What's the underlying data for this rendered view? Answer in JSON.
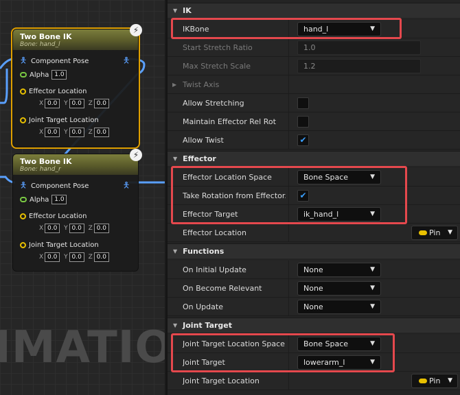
{
  "graph": {
    "watermark": "IMATION",
    "nodes": [
      {
        "title": "Two Bone IK",
        "subtitle": "Bone: hand_l",
        "component_pose": "Component Pose",
        "alpha_label": "Alpha",
        "alpha_value": "1.0",
        "effector_label": "Effector Location",
        "effector": {
          "x": "0.0",
          "y": "0.0",
          "z": "0.0"
        },
        "joint_label": "Joint Target Location",
        "joint": {
          "x": "0.0",
          "y": "0.0",
          "z": "0.0"
        }
      },
      {
        "title": "Two Bone IK",
        "subtitle": "Bone: hand_r",
        "component_pose": "Component Pose",
        "alpha_label": "Alpha",
        "alpha_value": "1.0",
        "effector_label": "Effector Location",
        "effector": {
          "x": "0.0",
          "y": "0.0",
          "z": "0.0"
        },
        "joint_label": "Joint Target Location",
        "joint": {
          "x": "0.0",
          "y": "0.0",
          "z": "0.0"
        }
      }
    ],
    "axis_labels": {
      "x": "X",
      "y": "Y",
      "z": "Z"
    },
    "pose_icon": "person-icon",
    "bolt_icon": "lightning-bolt-icon"
  },
  "panel": {
    "ik": {
      "category": "IK",
      "ikbone_label": "IKBone",
      "ikbone_value": "hand_l",
      "start_stretch_label": "Start Stretch Ratio",
      "start_stretch_value": "1.0",
      "max_stretch_label": "Max Stretch Scale",
      "max_stretch_value": "1.2",
      "twist_axis_label": "Twist Axis",
      "allow_stretching_label": "Allow Stretching",
      "allow_stretching": false,
      "maintain_label": "Maintain Effector Rel Rot",
      "maintain": false,
      "allow_twist_label": "Allow Twist",
      "allow_twist": true
    },
    "effector": {
      "category": "Effector",
      "space_label": "Effector Location Space",
      "space_value": "Bone Space",
      "take_rot_label": "Take Rotation from Effector...",
      "take_rot": true,
      "target_label": "Effector Target",
      "target_value": "ik_hand_l",
      "location_label": "Effector Location",
      "pin_label": "Pin"
    },
    "functions": {
      "category": "Functions",
      "initial_update_label": "On Initial Update",
      "initial_update_value": "None",
      "become_relevant_label": "On Become Relevant",
      "become_relevant_value": "None",
      "on_update_label": "On Update",
      "on_update_value": "None"
    },
    "joint": {
      "category": "Joint Target",
      "space_label": "Joint Target Location Space",
      "space_value": "Bone Space",
      "target_label": "Joint Target",
      "target_value": "lowerarm_l",
      "location_label": "Joint Target Location",
      "pin_label": "Pin"
    }
  },
  "colors": {
    "highlight": "#e5484d",
    "selection": "#e0a000",
    "check": "#3aa0ff",
    "vector_pin": "#e8c000",
    "bool_pin": "#7ac943",
    "pose_pin": "#5aa0ff"
  }
}
